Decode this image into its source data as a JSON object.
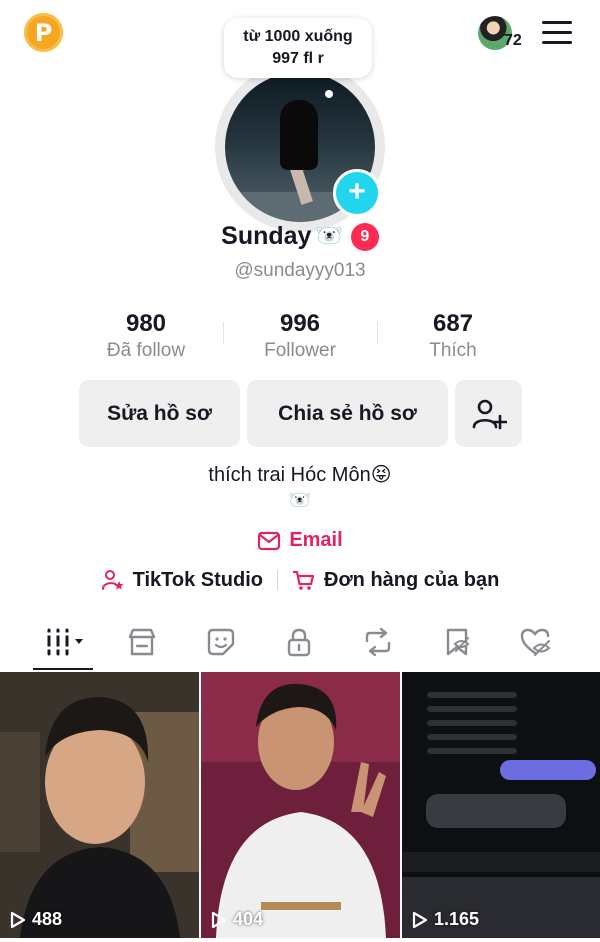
{
  "bubble": {
    "line1": "từ 1000 xuống",
    "line2": "997 fl r"
  },
  "top": {
    "notification_count": "72"
  },
  "profile": {
    "name": "Sunday",
    "name_emoji": "🐻‍❄️",
    "badge": "9",
    "handle": "@sundayyy013"
  },
  "stats": [
    {
      "value": "980",
      "label": "Đã follow"
    },
    {
      "value": "996",
      "label": "Follower"
    },
    {
      "value": "687",
      "label": "Thích"
    }
  ],
  "buttons": {
    "edit": "Sửa hồ sơ",
    "share": "Chia sẻ hồ sơ"
  },
  "bio": {
    "text": "thích trai Hóc Môn😝",
    "emoji": "🐻‍❄️"
  },
  "email_label": "Email",
  "links": {
    "studio": "TikTok Studio",
    "orders": "Đơn hàng của bạn"
  },
  "videos": [
    {
      "views": "488"
    },
    {
      "views": "404"
    },
    {
      "views": "1.165"
    }
  ],
  "colors": {
    "accent_red": "#fe2c55",
    "email": "#e0245e",
    "plus": "#20d5ec",
    "coin": "#f5a623"
  }
}
